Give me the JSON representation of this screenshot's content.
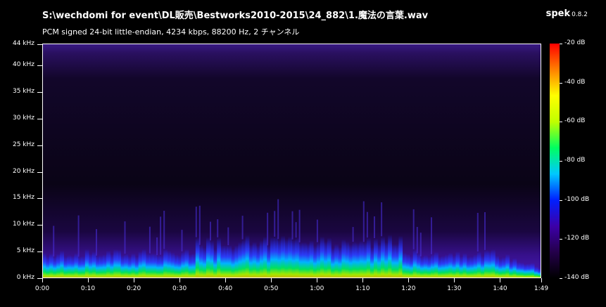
{
  "header": {
    "file_title": "S:\\wechdomi for event\\DL販売\\Bestworks2010-2015\\24_882\\1.魔法の言葉.wav",
    "format_info": "PCM signed 24-bit little-endian, 4234 kbps, 88200 Hz, 2 チャンネル",
    "app_name": "spek",
    "app_version": "0.8.2"
  },
  "y_axis": {
    "unit": "kHz",
    "labels": [
      "44 kHz",
      "40 kHz",
      "35 kHz",
      "30 kHz",
      "25 kHz",
      "20 kHz",
      "15 kHz",
      "10 kHz",
      "5 kHz",
      "0 kHz"
    ],
    "values": [
      44,
      40,
      35,
      30,
      25,
      20,
      15,
      10,
      5,
      0
    ],
    "range": [
      0,
      44.1
    ]
  },
  "x_axis": {
    "labels": [
      "0:00",
      "0:10",
      "0:20",
      "0:30",
      "0:40",
      "0:50",
      "1:00",
      "1:10",
      "1:20",
      "1:30",
      "1:40",
      "1:49"
    ],
    "seconds": [
      0,
      10,
      20,
      30,
      40,
      50,
      60,
      70,
      80,
      90,
      100,
      109
    ],
    "range": [
      0,
      109
    ]
  },
  "colorbar": {
    "labels": [
      "-20 dB",
      "-40 dB",
      "-60 dB",
      "-80 dB",
      "-100 dB",
      "-120 dB",
      "-140 dB"
    ],
    "values": [
      -20,
      -40,
      -60,
      -80,
      -100,
      -120,
      -140
    ],
    "range": [
      -140,
      -20
    ],
    "stops": [
      "#000000",
      "#24004a",
      "#3c00a8",
      "#0020ff",
      "#00c8ff",
      "#00ff60",
      "#c0ff00",
      "#ffff00",
      "#ff8000",
      "#ff0000"
    ]
  }
}
